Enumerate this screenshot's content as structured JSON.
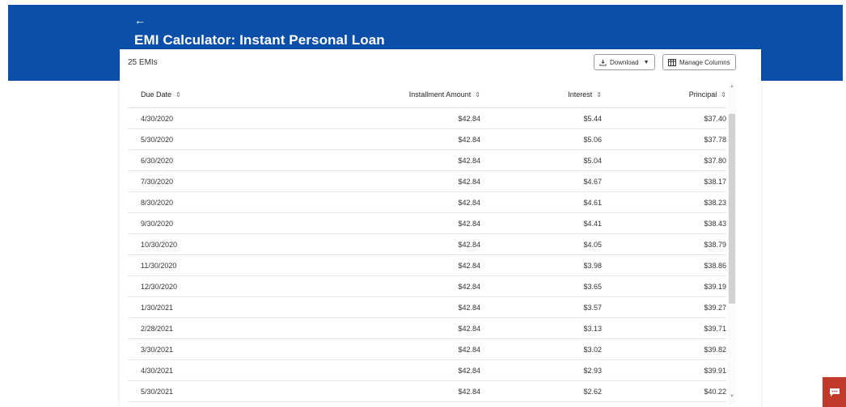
{
  "header": {
    "back_glyph": "←",
    "title": "EMI Calculator: Instant Personal Loan"
  },
  "toolbar": {
    "count": "25 EMIs",
    "download_label": "Download",
    "manage_label": "Manage Columns"
  },
  "table": {
    "columns": [
      "Due Date",
      "Installment Amount",
      "Interest",
      "Principal"
    ],
    "rows": [
      [
        "4/30/2020",
        "$42.84",
        "$5.44",
        "$37.40"
      ],
      [
        "5/30/2020",
        "$42.84",
        "$5.06",
        "$37.78"
      ],
      [
        "6/30/2020",
        "$42.84",
        "$5.04",
        "$37.80"
      ],
      [
        "7/30/2020",
        "$42.84",
        "$4.67",
        "$38.17"
      ],
      [
        "8/30/2020",
        "$42.84",
        "$4.61",
        "$38.23"
      ],
      [
        "9/30/2020",
        "$42.84",
        "$4.41",
        "$38.43"
      ],
      [
        "10/30/2020",
        "$42.84",
        "$4.05",
        "$38.79"
      ],
      [
        "11/30/2020",
        "$42.84",
        "$3.98",
        "$38.86"
      ],
      [
        "12/30/2020",
        "$42.84",
        "$3.65",
        "$39.19"
      ],
      [
        "1/30/2021",
        "$42.84",
        "$3.57",
        "$39.27"
      ],
      [
        "2/28/2021",
        "$42.84",
        "$3.13",
        "$39.71"
      ],
      [
        "3/30/2021",
        "$42.84",
        "$3.02",
        "$39.82"
      ],
      [
        "4/30/2021",
        "$42.84",
        "$2.93",
        "$39.91"
      ],
      [
        "5/30/2021",
        "$42.84",
        "$2.62",
        "$40.22"
      ]
    ]
  },
  "colors": {
    "brand_blue": "#0b4fa8",
    "chat_red": "#c0392b"
  },
  "icons": {
    "download": "download-icon",
    "columns": "columns-icon",
    "sort": "sort-icon",
    "chat": "chat-icon"
  }
}
